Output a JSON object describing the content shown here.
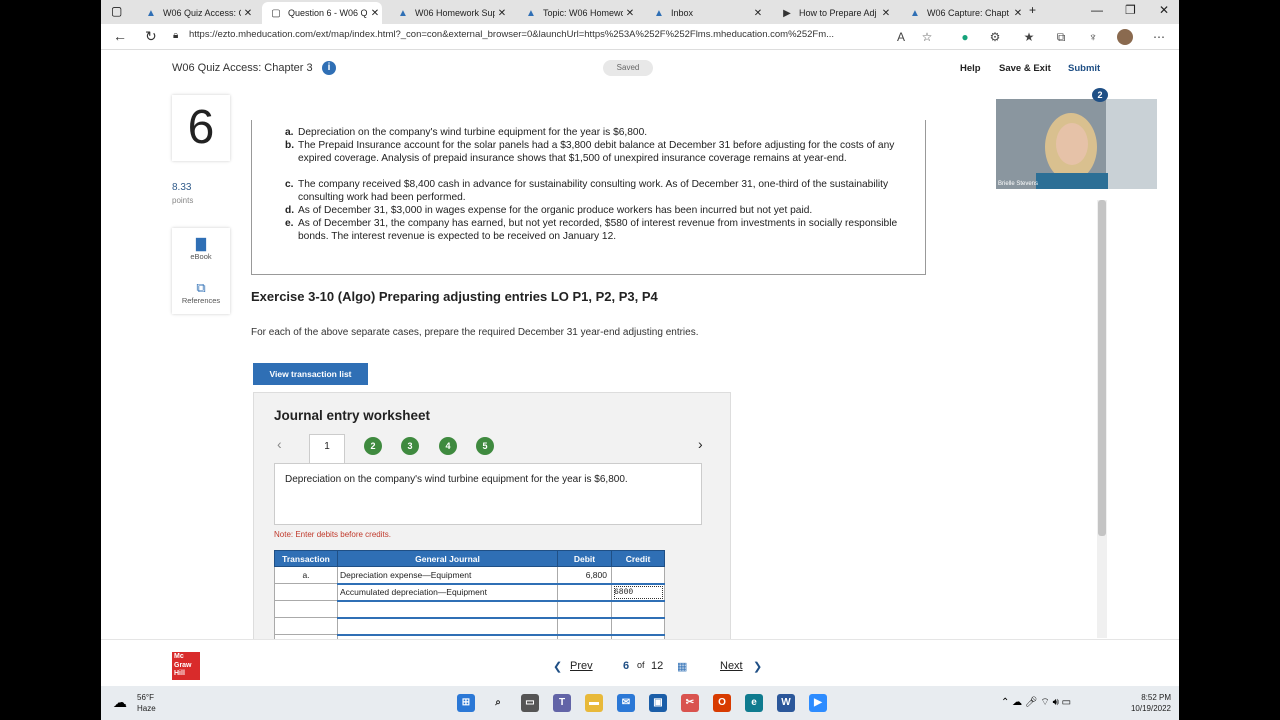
{
  "browser": {
    "tabs": [
      {
        "label": "W06 Quiz Access: Ch",
        "icon": "canvas-icon"
      },
      {
        "label": "Question 6 - W06 Qu",
        "icon": "page-icon",
        "active": true
      },
      {
        "label": "W06 Homework Sup",
        "icon": "canvas-icon"
      },
      {
        "label": "Topic: W06 Homewo",
        "icon": "canvas-icon"
      },
      {
        "label": "Inbox",
        "icon": "canvas-icon"
      },
      {
        "label": "How to Prepare Adj",
        "icon": "video-icon"
      },
      {
        "label": "W06 Capture: Chapt",
        "icon": "canvas-icon"
      }
    ],
    "url": "https://ezto.mheducation.com/ext/map/index.html?_con=con&external_browser=0&launchUrl=https%253A%252F%252Flms.mheducation.com%252Fm..."
  },
  "app_header": {
    "title": "W06 Quiz Access: Chapter 3",
    "saved": "Saved",
    "help": "Help",
    "save_exit": "Save & Exit",
    "submit": "Submit"
  },
  "rail": {
    "question_number": "6",
    "points": "8.33",
    "points_label": "points",
    "ebook": "eBook",
    "references": "References"
  },
  "cases": [
    {
      "letter": "a.",
      "text": "Depreciation on the company's wind turbine equipment for the year is $6,800."
    },
    {
      "letter": "b.",
      "text": "The Prepaid Insurance account for the solar panels had a $3,800 debit balance at December 31 before adjusting for the costs of any expired coverage. Analysis of prepaid insurance shows that $1,500 of unexpired insurance coverage remains at year-end."
    },
    {
      "letter": "c.",
      "text": "The company received $8,400 cash in advance for sustainability consulting work. As of December 31, one-third of the sustainability consulting work had been performed."
    },
    {
      "letter": "d.",
      "text": "As of December 31, $3,000 in wages expense for the organic produce workers has been incurred but not yet paid."
    },
    {
      "letter": "e.",
      "text": "As of December 31, the company has earned, but not yet recorded, $580 of interest revenue from investments in socially responsible bonds. The interest revenue is expected to be received on January 12."
    }
  ],
  "exercise": {
    "heading": "Exercise 3-10 (Algo) Preparing adjusting entries LO P1, P2, P3, P4",
    "instruction": "For each of the above separate cases, prepare the required December 31 year-end adjusting entries.",
    "view_button": "View transaction list"
  },
  "worksheet": {
    "title": "Journal entry worksheet",
    "current_step": "1",
    "steps": [
      "2",
      "3",
      "4",
      "5"
    ],
    "description": "Depreciation on the company's wind turbine equipment for the year is $6,800.",
    "note": "Note: Enter debits before credits.",
    "columns": [
      "Transaction",
      "General Journal",
      "Debit",
      "Credit"
    ],
    "rows": [
      [
        "a.",
        "Depreciation expense—Equipment",
        "6,800",
        ""
      ],
      [
        "",
        "Accumulated depreciation—Equipment",
        "",
        "6800"
      ],
      [
        "",
        "",
        "",
        ""
      ],
      [
        "",
        "",
        "",
        ""
      ],
      [
        "",
        "",
        "",
        ""
      ]
    ]
  },
  "video": {
    "name": "Brielle Stevens",
    "badge": "2"
  },
  "pager": {
    "prev": "Prev",
    "current": "6",
    "of": "of",
    "total": "12",
    "next": "Next"
  },
  "logo": {
    "line1": "Mc",
    "line2": "Graw",
    "line3": "Hill"
  },
  "taskbar": {
    "temperature": "56°F",
    "condition": "Haze",
    "time": "8:52 PM",
    "date": "10/19/2022"
  }
}
